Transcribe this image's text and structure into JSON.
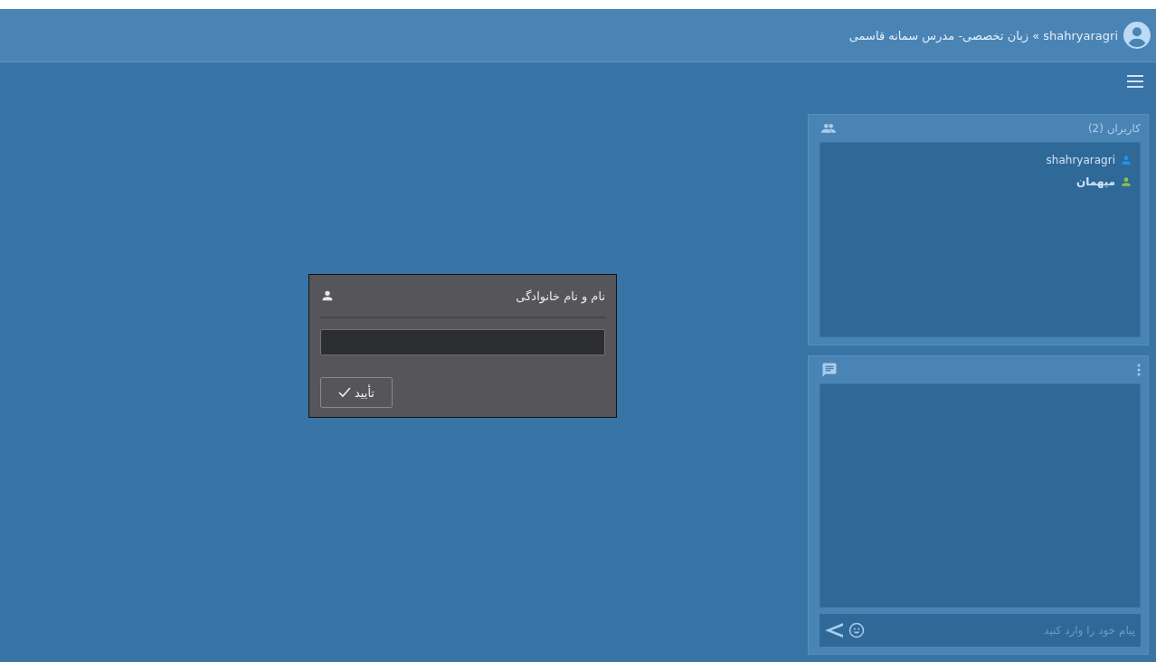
{
  "header": {
    "title": "shahryaragri » زبان تخصصی- مدرس سمانه قاسمی"
  },
  "users_panel": {
    "title": "کاربران (2)",
    "users": [
      {
        "name": "shahryaragri",
        "color": "#2196f3",
        "bold": false
      },
      {
        "name": "میهمان",
        "color": "#8bc34a",
        "bold": true
      }
    ]
  },
  "chat_panel": {
    "message_field": {
      "placeholder": "پیام خود را وارد کنید"
    }
  },
  "dialog": {
    "title": "نام و نام خانوادگی",
    "confirm_button": "تأیید"
  }
}
